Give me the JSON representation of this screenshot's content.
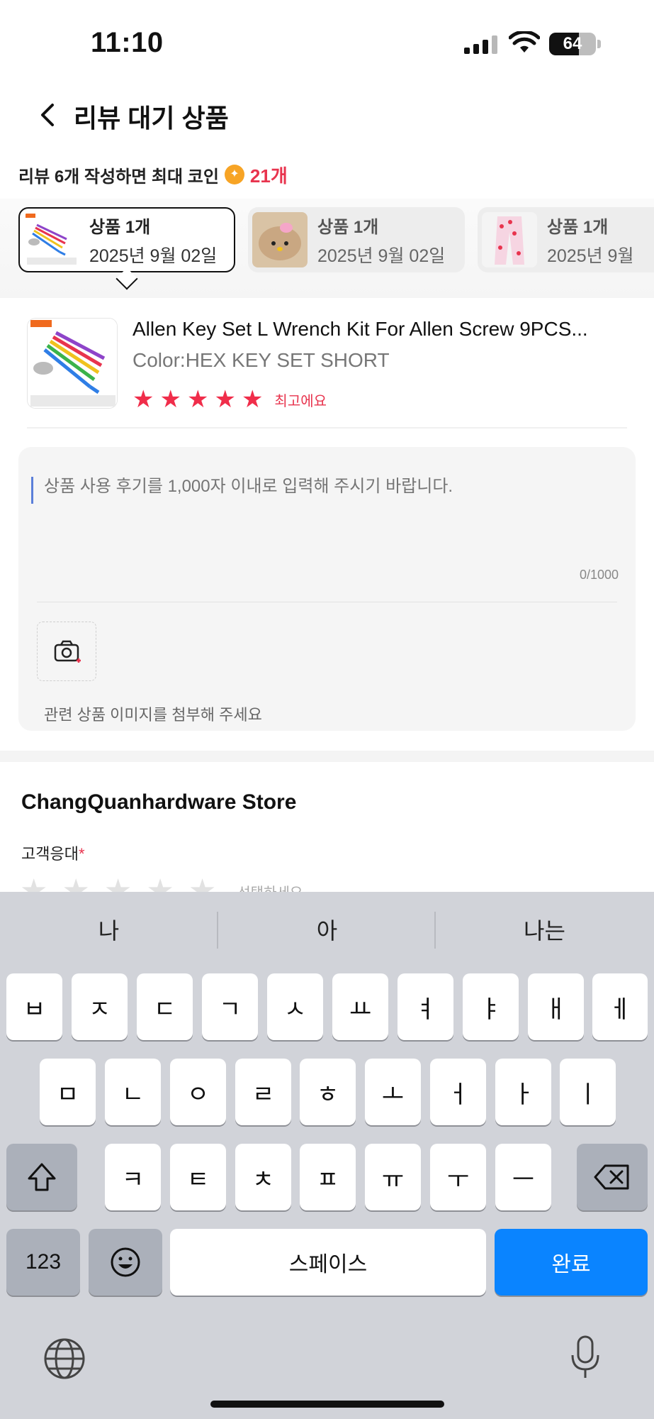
{
  "status_bar": {
    "time": "11:10",
    "battery": "64",
    "battery_level": 0.64
  },
  "header": {
    "title": "리뷰 대기 상품"
  },
  "promo": {
    "text": "리뷰 6개 작성하면 최대 코인",
    "count": "21개"
  },
  "product_cards": [
    {
      "qty": "상품 1개",
      "date": "2025년 9월 02일",
      "selected": true
    },
    {
      "qty": "상품 1개",
      "date": "2025년 9월 02일",
      "selected": false
    },
    {
      "qty": "상품 1개",
      "date": "2025년 9월",
      "selected": false
    }
  ],
  "product": {
    "name": "Allen Key Set L Wrench Kit For Allen Screw 9PCS...",
    "color": "Color:HEX KEY SET SHORT",
    "rating": 5,
    "rating_text": "최고에요"
  },
  "review": {
    "placeholder": "상품 사용 후기를 1,000자 이내로 입력해 주시기 바랍니다.",
    "char_count": "0/1000",
    "photo_hint": "관련 상품 이미지를 첨부해 주세요"
  },
  "store": {
    "name": "ChangQuanhardware Store",
    "service_label": "고객응대",
    "required_mark": "*",
    "select_hint": "선택하세요"
  },
  "keyboard": {
    "suggestions": [
      "나",
      "아",
      "나는"
    ],
    "row1": [
      "ㅂ",
      "ㅈ",
      "ㄷ",
      "ㄱ",
      "ㅅ",
      "ㅛ",
      "ㅕ",
      "ㅑ",
      "ㅐ",
      "ㅔ"
    ],
    "row2": [
      "ㅁ",
      "ㄴ",
      "ㅇ",
      "ㄹ",
      "ㅎ",
      "ㅗ",
      "ㅓ",
      "ㅏ",
      "ㅣ"
    ],
    "row3": [
      "ㅋ",
      "ㅌ",
      "ㅊ",
      "ㅍ",
      "ㅠ",
      "ㅜ",
      "ㅡ"
    ],
    "numbers_key": "123",
    "space_key": "스페이스",
    "done_key": "완료"
  },
  "colors": {
    "accent_red": "#e8344e",
    "keyboard_blue": "#0a84ff"
  }
}
